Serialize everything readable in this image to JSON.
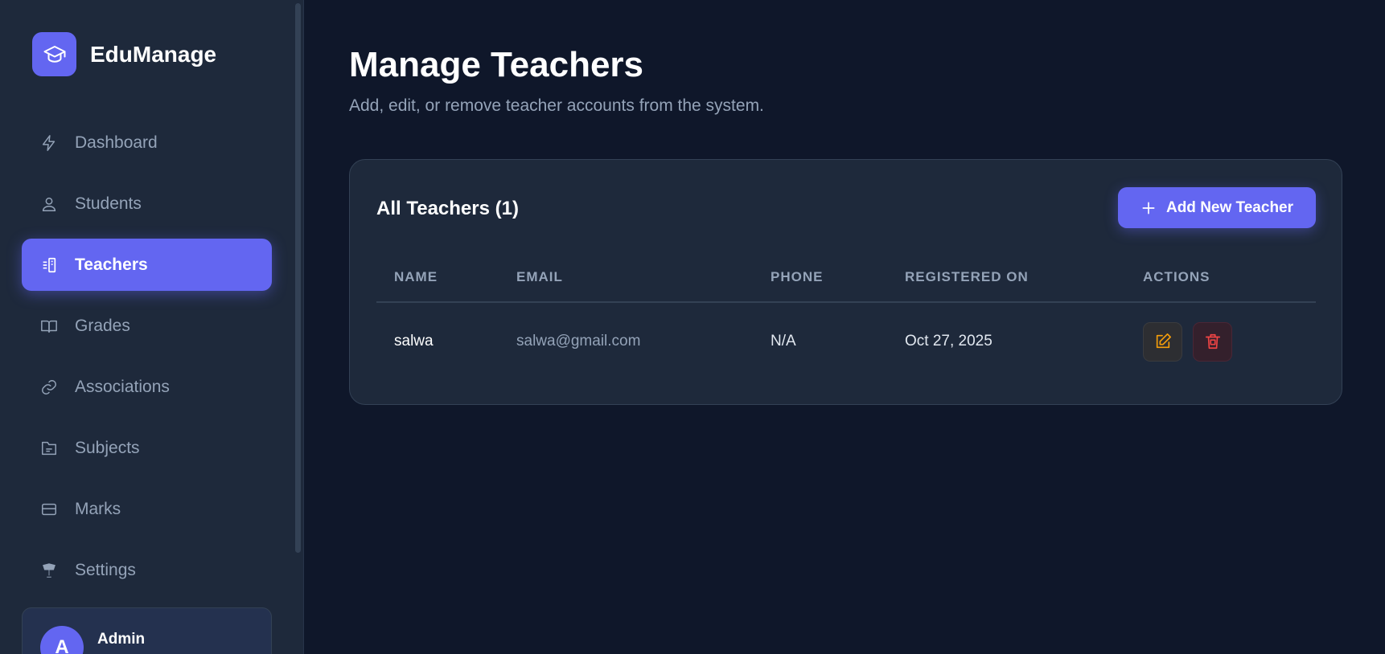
{
  "brand": {
    "name": "EduManage",
    "icon": "graduation-cap-icon"
  },
  "sidebar": {
    "items": [
      {
        "label": "Dashboard",
        "icon": "lightning-icon",
        "active": false
      },
      {
        "label": "Students",
        "icon": "user-icon",
        "active": false
      },
      {
        "label": "Teachers",
        "icon": "teacher-icon",
        "active": true
      },
      {
        "label": "Grades",
        "icon": "book-open-icon",
        "active": false
      },
      {
        "label": "Associations",
        "icon": "link-icon",
        "active": false
      },
      {
        "label": "Subjects",
        "icon": "folder-icon",
        "active": false
      },
      {
        "label": "Marks",
        "icon": "card-icon",
        "active": false
      },
      {
        "label": "Settings",
        "icon": "settings-icon",
        "active": false
      }
    ],
    "user": {
      "avatar_letter": "A",
      "name": "Admin"
    }
  },
  "main": {
    "title": "Manage Teachers",
    "subtitle": "Add, edit, or remove teacher accounts from the system.",
    "card": {
      "title": "All Teachers (1)",
      "add_button_label": "Add New Teacher",
      "columns": [
        "NAME",
        "EMAIL",
        "PHONE",
        "REGISTERED ON",
        "ACTIONS"
      ],
      "rows": [
        {
          "name": "salwa",
          "email": "salwa@gmail.com",
          "phone": "N/A",
          "registered_on": "Oct 27, 2025"
        }
      ]
    }
  },
  "colors": {
    "accent": "#6366f1",
    "background": "#0f172a",
    "surface": "#1e293b",
    "edit": "#f59e0b",
    "delete": "#ef4444"
  }
}
